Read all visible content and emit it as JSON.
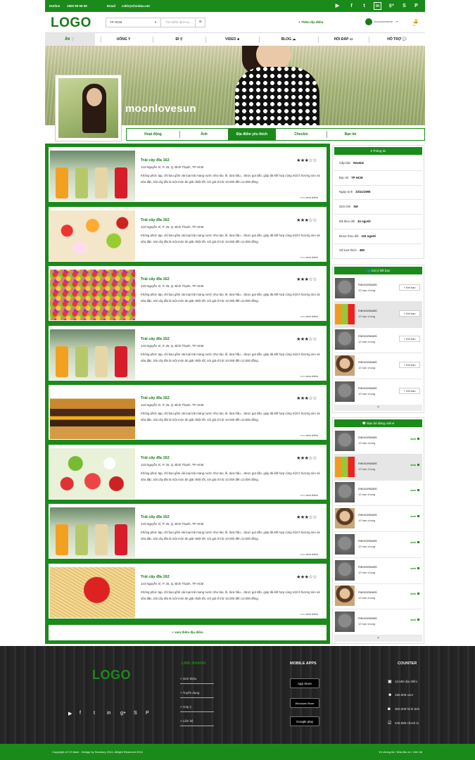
{
  "topbar": {
    "hotline_label": "Hotline",
    "hotline": "1900 59 59 59",
    "email_label": "Email",
    "email": "cskh@choidau.net",
    "social_icons": [
      "play-icon",
      "facebook-icon",
      "twitter-icon",
      "linkedin-icon",
      "googleplus-icon",
      "skype-icon",
      "pinterest-icon"
    ]
  },
  "header": {
    "logo": "LOGO",
    "city": "TP HCM",
    "search_placeholder": "Tìm kiếm dịch vụ ...",
    "add_place": "+ Thêm địa điểm",
    "user_name": "bonocomaxum",
    "notif_count": "14"
  },
  "nav": [
    "ĂN",
    "UỐNG",
    "ĐI",
    "VIDEO",
    "BLOG",
    "HỎI ĐÁP",
    "HỖ TRỢ"
  ],
  "profile": {
    "username": "moonlovesun",
    "tabs": [
      "Hoạt động",
      "Ảnh",
      "Địa điểm yêu thích",
      "Checkin",
      "Bạn bè"
    ],
    "active_tab": 2
  },
  "places": [
    {
      "title": "Trái cây đĩa 162",
      "address": "123 Nguyễn Xí, P. 25, Q. Bình Thạnh, TP HCM",
      "desc": "Không phức tạp, chỉ bao gồm vài loại trái mang nước như táo, lê, dưa hấu... được gọt sẵn, giúp đá kết hợp cùng một ít hương siro và sữa đặc, trái cây đĩa là một món ăn giải nhiệt tốt, với giá chỉ từ 10.000 đến 12.000 đồng.",
      "rating": 3,
      "more": ">>> xem thêm",
      "image": "juice"
    },
    {
      "title": "Trái cây đĩa 162",
      "address": "123 Nguyễn Xí, P. 25, Q. Bình Thạnh, TP HCM",
      "desc": "Không phức tạp, chỉ bao gồm vài loại trái mang nước như táo, lê, dưa hấu... được gọt sẵn, giúp đá kết hợp cùng một ít hương siro và sữa đặc, trái cây đĩa là một món ăn giải nhiệt tốt, với giá chỉ từ 10.000 đến 12.000 đồng.",
      "rating": 3,
      "more": ">>> xem thêm",
      "image": "fruit"
    },
    {
      "title": "Trái cây đĩa 162",
      "address": "123 Nguyễn Xí, P. 25, Q. Bình Thạnh, TP HCM",
      "desc": "Không phức tạp, chỉ bao gồm vài loại trái mang nước như táo, lê, dưa hấu... được gọt sẵn, giúp đá kết hợp cùng một ít hương siro và sữa đặc, trái cây đĩa là một món ăn giải nhiệt tốt, với giá chỉ từ 10.000 đến 12.000 đồng.",
      "rating": 3,
      "more": ">>> xem thêm",
      "image": "cereal"
    },
    {
      "title": "Trái cây đĩa 162",
      "address": "123 Nguyễn Xí, P. 25, Q. Bình Thạnh, TP HCM",
      "desc": "Không phức tạp, chỉ bao gồm vài loại trái mang nước như táo, lê, dưa hấu... được gọt sẵn, giúp đá kết hợp cùng một ít hương siro và sữa đặc, trái cây đĩa là một món ăn giải nhiệt tốt, với giá chỉ từ 10.000 đến 12.000 đồng.",
      "rating": 3,
      "more": ">>> xem thêm",
      "image": "juice"
    },
    {
      "title": "Trái cây đĩa 162",
      "address": "123 Nguyễn Xí, P. 25, Q. Bình Thạnh, TP HCM",
      "desc": "Không phức tạp, chỉ bao gồm vài loại trái mang nước như táo, lê, dưa hấu... được gọt sẵn, giúp đá kết hợp cùng một ít hương siro và sữa đặc, trái cây đĩa là một món ăn giải nhiệt tốt, với giá chỉ từ 10.000 đến 12.000 đồng.",
      "rating": 3,
      "more": ">>> xem thêm",
      "image": "burger"
    },
    {
      "title": "Trái cây đĩa 162",
      "address": "123 Nguyễn Xí, P. 25, Q. Bình Thạnh, TP HCM",
      "desc": "Không phức tạp, chỉ bao gồm vài loại trái mang nước như táo, lê, dưa hấu... được gọt sẵn, giúp đá kết hợp cùng một ít hương siro và sữa đặc, trái cây đĩa là một món ăn giải nhiệt tốt, với giá chỉ từ 10.000 đến 12.000 đồng.",
      "rating": 3,
      "more": ">>> xem thêm",
      "image": "veg"
    },
    {
      "title": "Trái cây đĩa 162",
      "address": "123 Nguyễn Xí, P. 25, Q. Bình Thạnh, TP HCM",
      "desc": "Không phức tạp, chỉ bao gồm vài loại trái mang nước như táo, lê, dưa hấu... được gọt sẵn, giúp đá kết hợp cùng một ít hương siro và sữa đặc, trái cây đĩa là một món ăn giải nhiệt tốt, với giá chỉ từ 10.000 đến 12.000 đồng.",
      "rating": 3,
      "more": ">>> xem thêm",
      "image": "juice"
    },
    {
      "title": "Trái cây đĩa 162",
      "address": "123 Nguyễn Xí, P. 25, Q. Bình Thạnh, TP HCM",
      "desc": "Không phức tạp, chỉ bao gồm vài loại trái mang nước như táo, lê, dưa hấu... được gọt sẵn, giúp đá kết hợp cùng một ít hương siro và sữa đặc, trái cây đĩa là một món ăn giải nhiệt tốt, với giá chỉ từ 10.000 đến 12.000 đồng.",
      "rating": 3,
      "more": ">>> xem thêm",
      "image": "pasta"
    }
  ],
  "more_places": "+ xem thêm địa điểm",
  "info": {
    "title": "Thông tin",
    "rows": [
      {
        "label": "Cấp bậc",
        "value": "Newbie"
      },
      {
        "label": "Địa chỉ",
        "value": "TP HCM"
      },
      {
        "label": "Ngày sinh",
        "value": "23/11/1995"
      },
      {
        "label": "Giới tính",
        "value": "Nữ"
      },
      {
        "label": "Đã theo dõi",
        "value": "34 người"
      },
      {
        "label": "Được theo dõi",
        "value": "115 người"
      },
      {
        "label": "Số lượt thích",
        "value": "480"
      }
    ]
  },
  "suggest": {
    "title": "Gợi ý kết bạn",
    "button": "Kết bạn",
    "items": [
      {
        "name": "meoconsaosi",
        "sub": "12 bạn chung",
        "photo": "cat"
      },
      {
        "name": "meoconsaosi",
        "sub": "12 bạn chung",
        "photo": "juicy"
      },
      {
        "name": "meoconsaosi",
        "sub": "12 bạn chung",
        "photo": "cat"
      },
      {
        "name": "meoconsaosi",
        "sub": "12 bạn chung",
        "photo": "girl"
      },
      {
        "name": "meoconsaosi",
        "sub": "12 bạn chung",
        "photo": "cat"
      }
    ]
  },
  "online": {
    "title": "Bạn bè đang online",
    "status": "web",
    "items": [
      {
        "name": "meoconsaosi",
        "sub": "12 bạn chung",
        "photo": "cat"
      },
      {
        "name": "meoconsaosi",
        "sub": "12 bạn chung",
        "photo": "juicy"
      },
      {
        "name": "meoconsaosi",
        "sub": "12 bạn chung",
        "photo": "cat"
      },
      {
        "name": "meoconsaosi",
        "sub": "12 bạn chung",
        "photo": "girl"
      },
      {
        "name": "meoconsaosi",
        "sub": "12 bạn chung",
        "photo": "cat"
      },
      {
        "name": "meoconsaosi",
        "sub": "12 bạn chung",
        "photo": "cat"
      },
      {
        "name": "meoconsaosi",
        "sub": "12 bạn chung",
        "photo": "girl"
      },
      {
        "name": "meoconsaosi",
        "sub": "12 bạn chung",
        "photo": "cat"
      }
    ]
  },
  "footer": {
    "logo": "LOGO",
    "links_title": "LINK NHANH",
    "links": [
      "> Giới thiệu",
      "> Tuyển dụng",
      "> Góp ý",
      "> Liên hệ"
    ],
    "apps_title": "MOBILE APPS",
    "apps": [
      "App Store",
      "Windows Store",
      "Google play"
    ],
    "counter_title": "COUNTER",
    "counters": [
      {
        "icon": "map-icon",
        "text": "13.580 địa điểm"
      },
      {
        "icon": "users-icon",
        "text": "156.908 user"
      },
      {
        "icon": "camera-icon",
        "text": "300.009 hình ảnh"
      },
      {
        "icon": "checkin-icon",
        "text": "345.888 check in"
      }
    ],
    "copyright": "Copyright of CH team . Design by Sunstory 2014. Allright Reserved 2014",
    "bottom_links": "Về chúng tôi / Nhà đầu tư / Liên hệ"
  }
}
